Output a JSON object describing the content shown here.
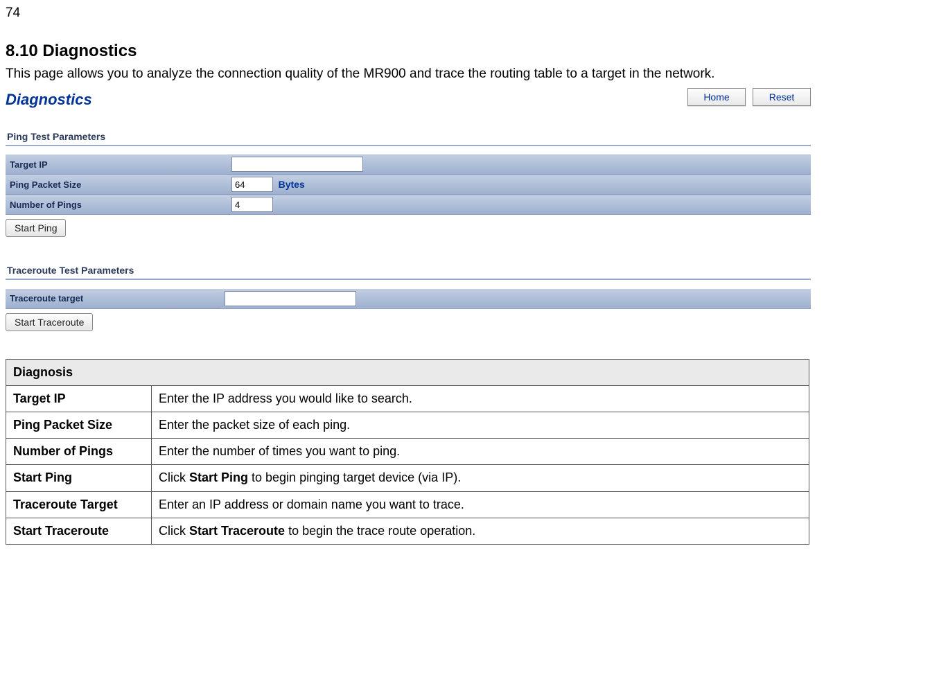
{
  "page_number": "74",
  "section_title": "8.10 Diagnostics",
  "intro_text": "This page allows you to analyze the connection quality of the MR900 and trace the routing table to a target in the network.",
  "ui": {
    "title": "Diagnostics",
    "home_btn": "Home",
    "reset_btn": "Reset",
    "ping": {
      "header": "Ping Test Parameters",
      "target_ip_label": "Target IP",
      "target_ip_value": "",
      "packet_size_label": "Ping Packet Size",
      "packet_size_value": "64",
      "packet_size_unit": "Bytes",
      "num_pings_label": "Number of Pings",
      "num_pings_value": "4",
      "start_btn": "Start Ping"
    },
    "traceroute": {
      "header": "Traceroute Test Parameters",
      "target_label": "Traceroute target",
      "target_value": "",
      "start_btn": "Start Traceroute"
    }
  },
  "desc_table": {
    "title": "Diagnosis",
    "rows": [
      {
        "label": "Target IP",
        "desc_pre": "Enter the IP address you would like to search.",
        "desc_bold": "",
        "desc_post": ""
      },
      {
        "label": "Ping Packet Size",
        "desc_pre": "Enter the packet size of each ping.",
        "desc_bold": "",
        "desc_post": ""
      },
      {
        "label": "Number of Pings",
        "desc_pre": "Enter the number of times you want to ping.",
        "desc_bold": "",
        "desc_post": ""
      },
      {
        "label": "Start Ping",
        "desc_pre": "Click ",
        "desc_bold": "Start Ping",
        "desc_post": " to begin pinging target device (via IP)."
      },
      {
        "label": "Traceroute Target",
        "desc_pre": "Enter an IP address or domain name you want to trace.",
        "desc_bold": "",
        "desc_post": ""
      },
      {
        "label": "Start Traceroute",
        "desc_pre": "Click ",
        "desc_bold": "Start Traceroute",
        "desc_post": " to begin the trace route operation."
      }
    ]
  }
}
